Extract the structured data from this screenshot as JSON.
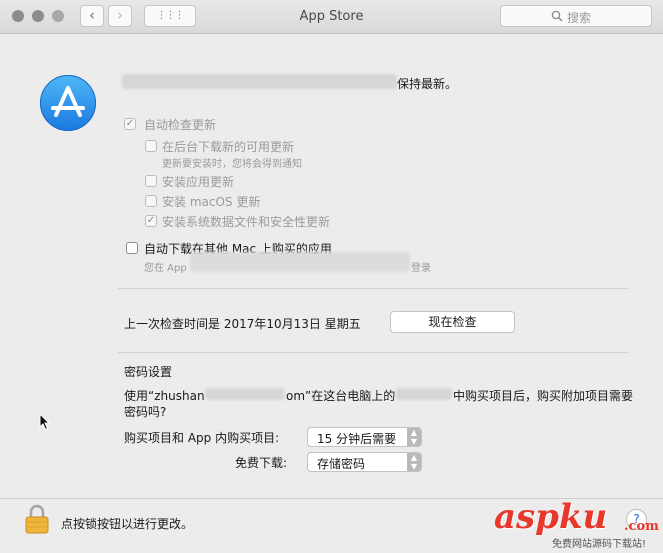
{
  "window": {
    "title": "App Store",
    "search_placeholder": "搜索"
  },
  "toolbar": {
    "back": "‹",
    "forward": "›",
    "show_all": "⋮⋮⋮"
  },
  "main": {
    "intro_suffix": "保持最新。",
    "auto_check": {
      "label": "自动检查更新",
      "checked": true
    },
    "sub_options": [
      {
        "label": "在后台下载新的可用更新",
        "note": "更新要安装时，您将会得到通知",
        "checked": false
      },
      {
        "label": "安装应用更新",
        "checked": false
      },
      {
        "label": "安装 macOS 更新",
        "checked": false
      },
      {
        "label": "安装系统数据文件和安全性更新",
        "checked": true
      }
    ],
    "auto_download": {
      "label": "自动下载在其他 Mac 上购买的应用",
      "note_prefix": "您在 App",
      "note_suffix": "登录",
      "checked": false
    },
    "last_check": "上一次检查时间是 2017年10月13日 星期五",
    "check_now": "现在检查"
  },
  "password": {
    "heading": "密码设置",
    "desc_line1_a": "使用“zhushan",
    "desc_line1_b": "om”在这台电脑上的",
    "desc_line1_c": "中购买项目后，购买附加项目需要",
    "desc_line2": "密码吗?",
    "purchases_label": "购买项目和 App 内购买项目:",
    "purchases_value": "15 分钟后需要",
    "free_label": "免费下载:",
    "free_value": "存储密码"
  },
  "footer": {
    "lock_text": "点按锁按钮以进行更改。",
    "help": "?"
  },
  "watermark": {
    "brand": "aspku",
    "tld": ".com",
    "tagline": "免费网站源码下载站!"
  }
}
